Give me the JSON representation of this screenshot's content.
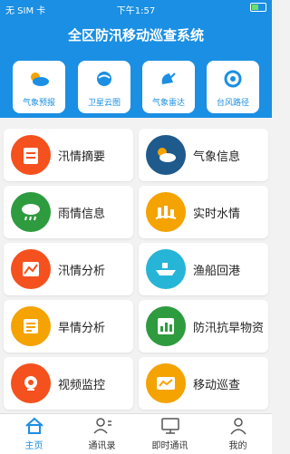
{
  "status_bar": {
    "carrier": "无 SIM 卡",
    "time": "下午1:57"
  },
  "app": {
    "title": "全区防汛移动巡查系统"
  },
  "tools": [
    {
      "label": "气象预报",
      "icon": "weather-forecast-icon"
    },
    {
      "label": "卫星云图",
      "icon": "satellite-cloud-icon"
    },
    {
      "label": "气象雷达",
      "icon": "radar-dish-icon"
    },
    {
      "label": "台风路径",
      "icon": "typhoon-icon"
    }
  ],
  "cards": [
    {
      "label": "汛情摘要",
      "icon": "notepad-icon",
      "color": "#f4511e"
    },
    {
      "label": "气象信息",
      "icon": "cloud-sun-icon",
      "color": "#1e5a8c"
    },
    {
      "label": "雨情信息",
      "icon": "rain-cloud-icon",
      "color": "#2e9b3f"
    },
    {
      "label": "实时水情",
      "icon": "water-level-icon",
      "color": "#f4a300"
    },
    {
      "label": "汛情分析",
      "icon": "image-chart-icon",
      "color": "#f4511e"
    },
    {
      "label": "渔船回港",
      "icon": "ship-icon",
      "color": "#26b5d6"
    },
    {
      "label": "旱情分析",
      "icon": "document-icon",
      "color": "#f4a300"
    },
    {
      "label": "防汛抗旱物资",
      "icon": "bar-chart-icon",
      "color": "#2e9b3f"
    },
    {
      "label": "视频监控",
      "icon": "camera-icon",
      "color": "#f4511e"
    },
    {
      "label": "移动巡查",
      "icon": "patrol-screen-icon",
      "color": "#f4a300"
    }
  ],
  "tabs": [
    {
      "label": "主页",
      "icon": "home-icon"
    },
    {
      "label": "通讯录",
      "icon": "contacts-icon"
    },
    {
      "label": "即时通讯",
      "icon": "monitor-icon"
    },
    {
      "label": "我的",
      "icon": "user-icon"
    }
  ],
  "colors": {
    "primary": "#1a8fe3",
    "background": "#f2f2f2"
  }
}
